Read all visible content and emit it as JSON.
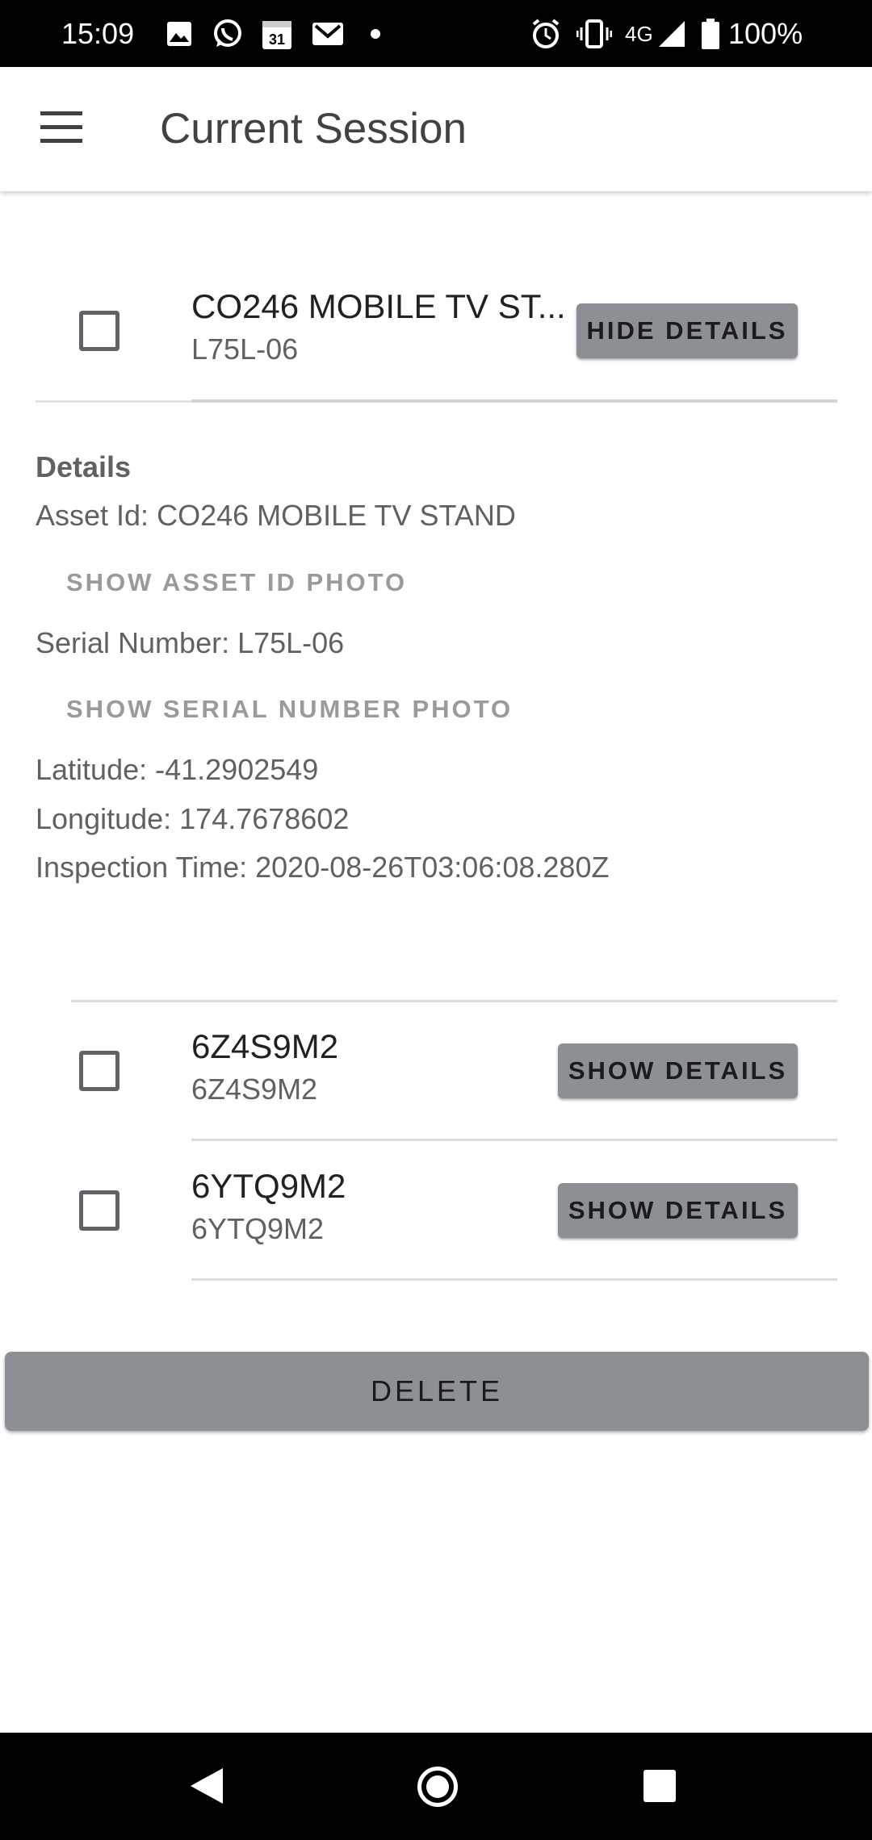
{
  "status_bar": {
    "time": "15:09",
    "left_icons": [
      "image-icon",
      "whatsapp-icon",
      "calendar-icon",
      "gmail-icon",
      "dot-icon"
    ],
    "calendar_day": "31",
    "network": "4G",
    "battery": "100%"
  },
  "app_bar": {
    "title": "Current Session",
    "menu_icon": "hamburger-menu-icon"
  },
  "items": [
    {
      "title": "CO246 MOBILE TV ST...",
      "subtitle": "L75L-06",
      "button": "HIDE DETAILS"
    },
    {
      "title": "6Z4S9M2",
      "subtitle": "6Z4S9M2",
      "button": "SHOW DETAILS"
    },
    {
      "title": "6YTQ9M2",
      "subtitle": "6YTQ9M2",
      "button": "SHOW DETAILS"
    }
  ],
  "details": {
    "heading": "Details",
    "asset_id": "Asset Id: CO246 MOBILE TV STAND",
    "show_asset_photo": "SHOW ASSET ID PHOTO",
    "serial_number": "Serial Number: L75L-06",
    "show_serial_photo": "SHOW SERIAL NUMBER PHOTO",
    "latitude": "Latitude: -41.2902549",
    "longitude": "Longitude: 174.7678602",
    "inspection_time": "Inspection Time: 2020-08-26T03:06:08.280Z"
  },
  "delete_label": "DELETE",
  "nav_bar": {
    "back_icon": "back-triangle-icon",
    "home_icon": "home-circle-icon",
    "recents_icon": "recents-square-icon"
  },
  "colors": {
    "button_grey": "#8c8f94",
    "text_secondary": "#616161",
    "text_button_muted": "#9a9a9a"
  }
}
